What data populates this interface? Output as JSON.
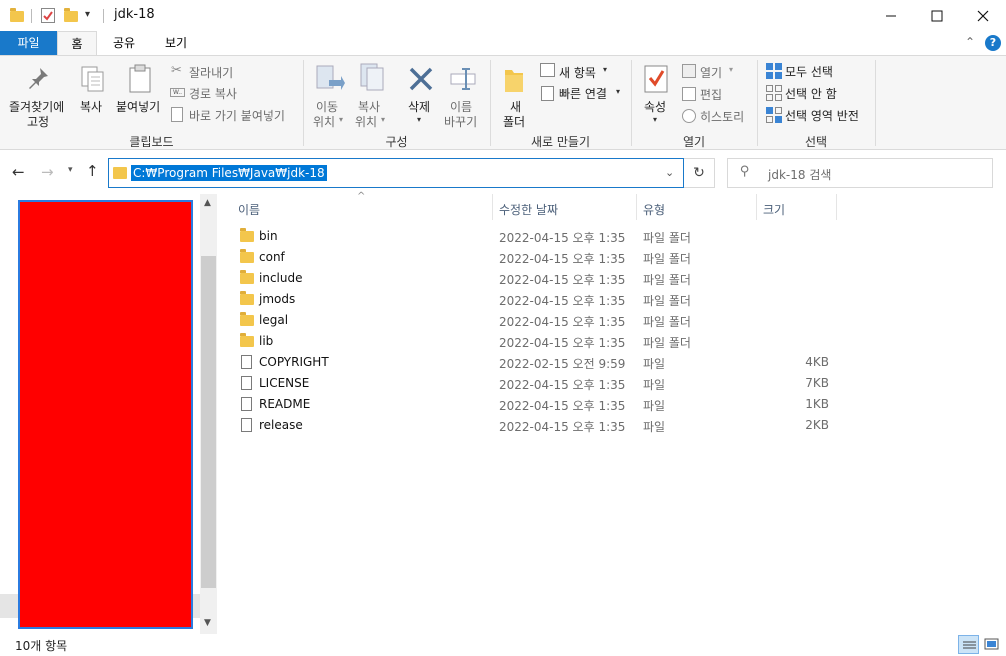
{
  "window": {
    "title": "jdk-18"
  },
  "tabs": {
    "file": "파일",
    "home": "홈",
    "share": "공유",
    "view": "보기"
  },
  "ribbon": {
    "pin_line1": "즐겨찾기에",
    "pin_line2": "고정",
    "copy": "복사",
    "paste": "붙여넣기",
    "cut": "잘라내기",
    "copy_path": "경로 복사",
    "paste_shortcut": "바로 가기 붙여넣기",
    "clipboard_group": "클립보드",
    "move_line1": "이동",
    "move_line2": "위치",
    "copyto_line1": "복사",
    "copyto_line2": "위치",
    "delete": "삭제",
    "rename_line1": "이름",
    "rename_line2": "바꾸기",
    "organize_group": "구성",
    "new_folder_line1": "새",
    "new_folder_line2": "폴더",
    "new_item": "새 항목",
    "easy_access": "빠른 연결",
    "new_group": "새로 만들기",
    "properties": "속성",
    "open": "열기",
    "edit": "편집",
    "history": "히스토리",
    "open_group": "열기",
    "select_all": "모두 선택",
    "select_none": "선택 안 함",
    "invert_selection": "선택 영역 반전",
    "select_group": "선택"
  },
  "address": {
    "path": "C:₩Program Files₩Java₩jdk-18"
  },
  "search": {
    "placeholder": "jdk-18 검색"
  },
  "columns": {
    "name": "이름",
    "modified": "수정한 날짜",
    "type": "유형",
    "size": "크기"
  },
  "files": [
    {
      "name": "bin",
      "modified": "2022-04-15 오후 1:35",
      "type": "파일 폴더",
      "size": "",
      "kind": "folder"
    },
    {
      "name": "conf",
      "modified": "2022-04-15 오후 1:35",
      "type": "파일 폴더",
      "size": "",
      "kind": "folder"
    },
    {
      "name": "include",
      "modified": "2022-04-15 오후 1:35",
      "type": "파일 폴더",
      "size": "",
      "kind": "folder"
    },
    {
      "name": "jmods",
      "modified": "2022-04-15 오후 1:35",
      "type": "파일 폴더",
      "size": "",
      "kind": "folder"
    },
    {
      "name": "legal",
      "modified": "2022-04-15 오후 1:35",
      "type": "파일 폴더",
      "size": "",
      "kind": "folder"
    },
    {
      "name": "lib",
      "modified": "2022-04-15 오후 1:35",
      "type": "파일 폴더",
      "size": "",
      "kind": "folder"
    },
    {
      "name": "COPYRIGHT",
      "modified": "2022-02-15 오전 9:59",
      "type": "파일",
      "size": "4KB",
      "kind": "file"
    },
    {
      "name": "LICENSE",
      "modified": "2022-04-15 오후 1:35",
      "type": "파일",
      "size": "7KB",
      "kind": "file"
    },
    {
      "name": "README",
      "modified": "2022-04-15 오후 1:35",
      "type": "파일",
      "size": "1KB",
      "kind": "file"
    },
    {
      "name": "release",
      "modified": "2022-04-15 오후 1:35",
      "type": "파일",
      "size": "2KB",
      "kind": "file"
    }
  ],
  "status": {
    "count": "10개 항목"
  },
  "colors": {
    "accent": "#1979ca",
    "file_tab": "#1979ca",
    "redacted": "#ff0000",
    "selection": "#0078d7"
  }
}
